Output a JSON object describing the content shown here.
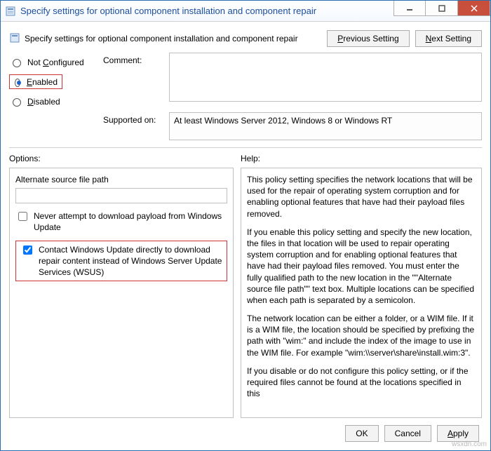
{
  "window": {
    "title": "Specify settings for optional component installation and component repair"
  },
  "header": {
    "subtitle": "Specify settings for optional component installation and component repair",
    "previous": "Previous Setting",
    "next": "Next Setting"
  },
  "state": {
    "not_configured": "Not Configured",
    "enabled": "Enabled",
    "disabled": "Disabled",
    "selected": "enabled"
  },
  "comment": {
    "label": "Comment:",
    "value": ""
  },
  "supported": {
    "label": "Supported on:",
    "value": "At least Windows Server 2012, Windows 8 or Windows RT"
  },
  "options": {
    "title": "Options:",
    "alt_source_label": "Alternate source file path",
    "alt_source_value": "",
    "never_download": "Never attempt to download payload from Windows Update",
    "never_download_checked": false,
    "wsus": "Contact Windows Update directly to download repair content instead of Windows Server Update Services (WSUS)",
    "wsus_checked": true
  },
  "help": {
    "title": "Help:",
    "p1": "This policy setting specifies the network locations that will be used for the repair of operating system corruption and for enabling optional features that have had their payload files removed.",
    "p2": "If you enable this policy setting and specify the new location, the files in that location will be used to repair operating system corruption and for enabling optional features that have had their payload files removed. You must enter the fully qualified path to the new location in the \"\"Alternate source file path\"\" text box. Multiple locations can be specified when each path is separated by a semicolon.",
    "p3": "The network location can be either a folder, or a WIM file. If it is a WIM file, the location should be specified by prefixing the path with \"wim:\" and include the index of the image to use in the WIM file. For example \"wim:\\\\server\\share\\install.wim:3\".",
    "p4": "If you disable or do not configure this policy setting, or if the required files cannot be found at the locations specified in this"
  },
  "buttons": {
    "ok": "OK",
    "cancel": "Cancel",
    "apply": "Apply"
  },
  "watermark": "wsxdn.com"
}
